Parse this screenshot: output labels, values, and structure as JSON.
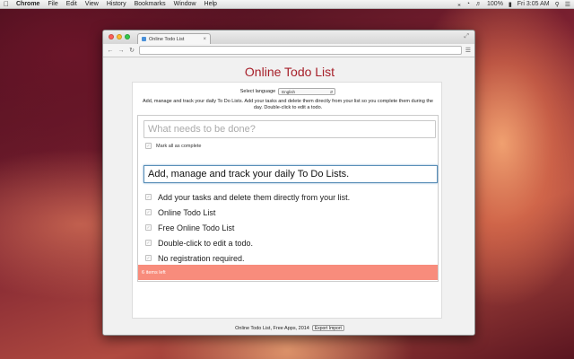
{
  "menubar": {
    "app": "Chrome",
    "items": [
      "File",
      "Edit",
      "View",
      "History",
      "Bookmarks",
      "Window",
      "Help"
    ],
    "battery": "100%",
    "clock": "Fri 3:05 AM"
  },
  "browser": {
    "tab_title": "Online Todo List",
    "url": ""
  },
  "page": {
    "title": "Online Todo List",
    "language_label": "Select language",
    "language_value": "English",
    "intro": "Add, manage and track your daily To Do Lists. Add your tasks and delete them directly from your list so you complete them during the day. Double-click to edit a todo.",
    "new_todo_placeholder": "What needs to be done?",
    "mark_all_label": "Mark all as complete",
    "editing_value": "Add, manage and track your daily To Do Lists.",
    "todos": [
      {
        "text": "Add your tasks and delete them directly from your list."
      },
      {
        "text": "Online Todo List"
      },
      {
        "text": "Free Online Todo List"
      },
      {
        "text": "Double-click to edit a todo."
      },
      {
        "text": "No registration required."
      }
    ],
    "items_left": "6 items left",
    "footer_text": "Online Todo List, Free Apps, 2014",
    "export_label": "Export",
    "import_label": "Import"
  },
  "colors": {
    "title": "#a7202a",
    "footer_bar": "#f88c7c"
  }
}
